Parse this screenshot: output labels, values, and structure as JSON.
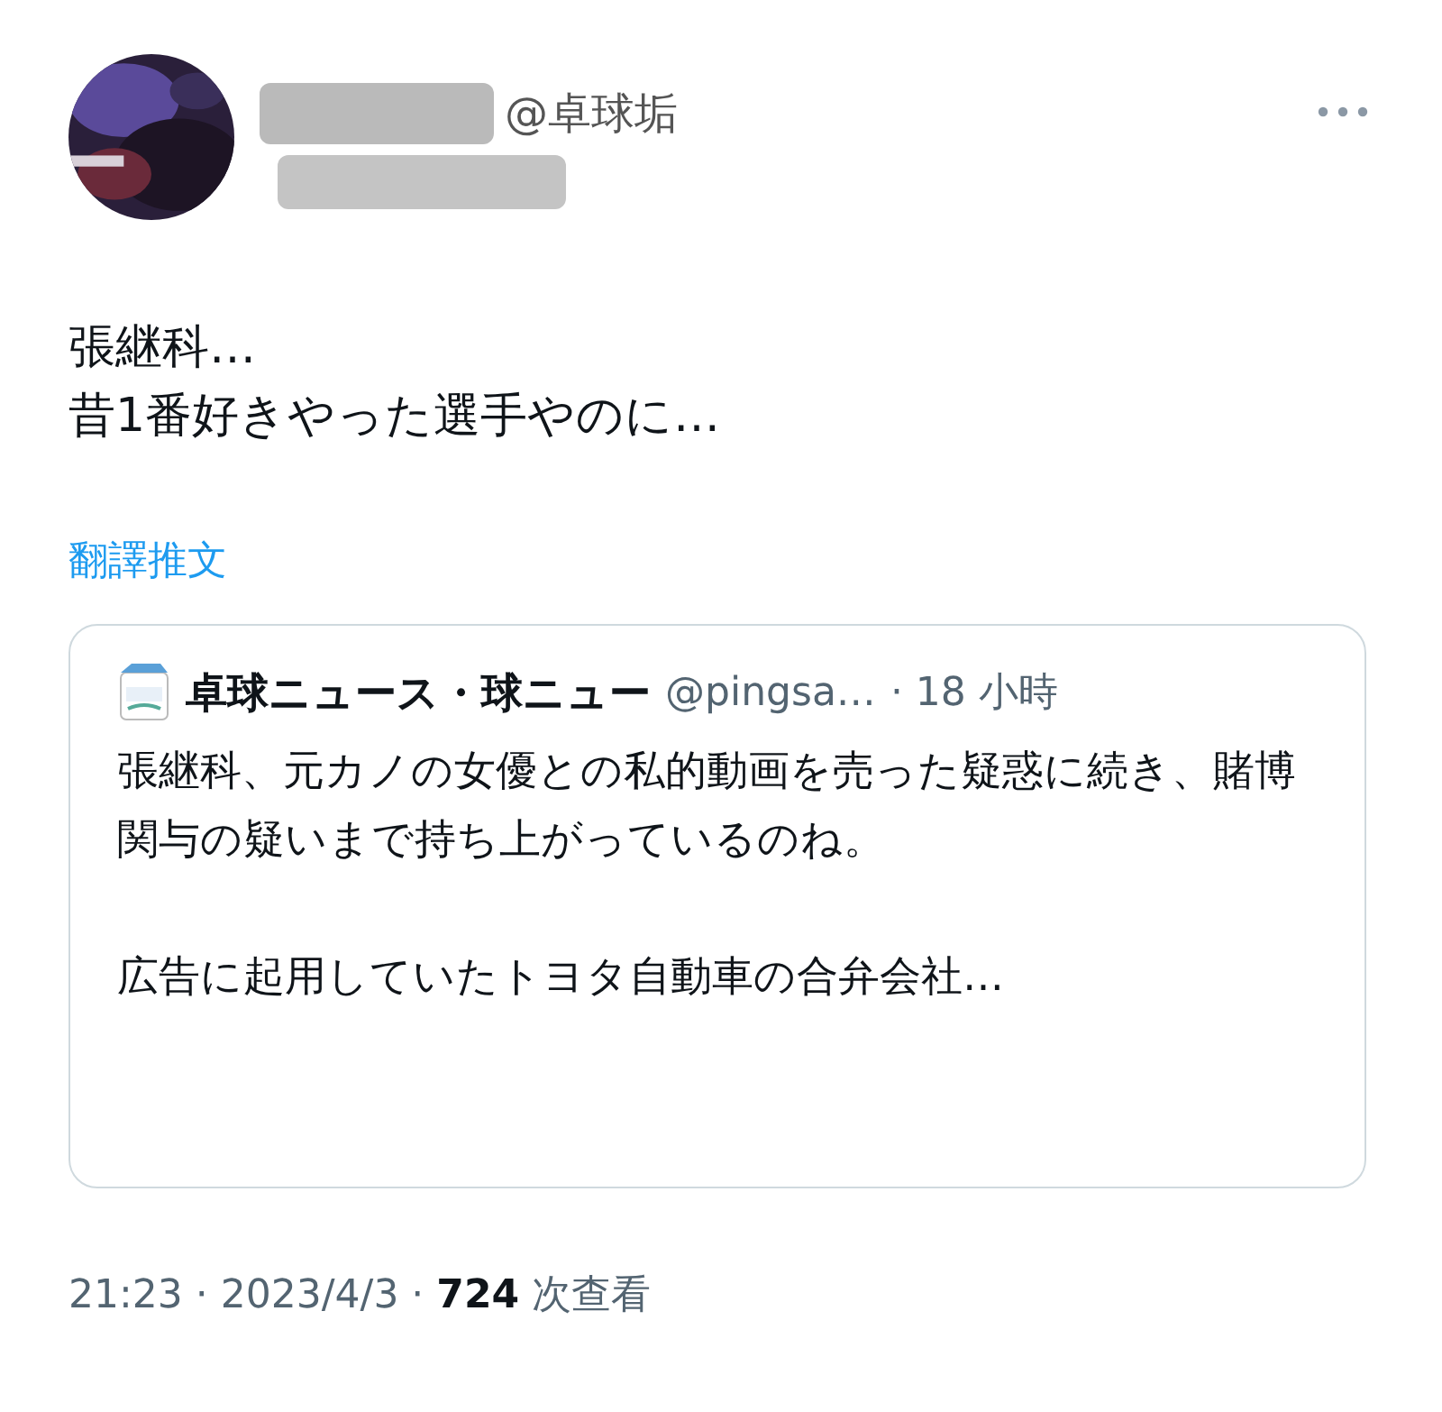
{
  "author": {
    "display_name": "@卓球垢"
  },
  "tweet": {
    "lines": [
      "張継科…",
      "昔1番好きやった選手やのに…"
    ]
  },
  "translate_link": "翻譯推文",
  "quote": {
    "name": "卓球ニュース・球ニュー",
    "handle": "@pingsa…",
    "time": "· 18 小時",
    "paragraphs": [
      "張継科、元カノの女優との私的動画を売った疑惑に続き、賭博関与の疑いまで持ち上がっているのね。",
      "広告に起用していたトヨタ自動車の合弁会社…"
    ]
  },
  "meta": "21:23 · 2023/4/3 · **724** 次查看"
}
